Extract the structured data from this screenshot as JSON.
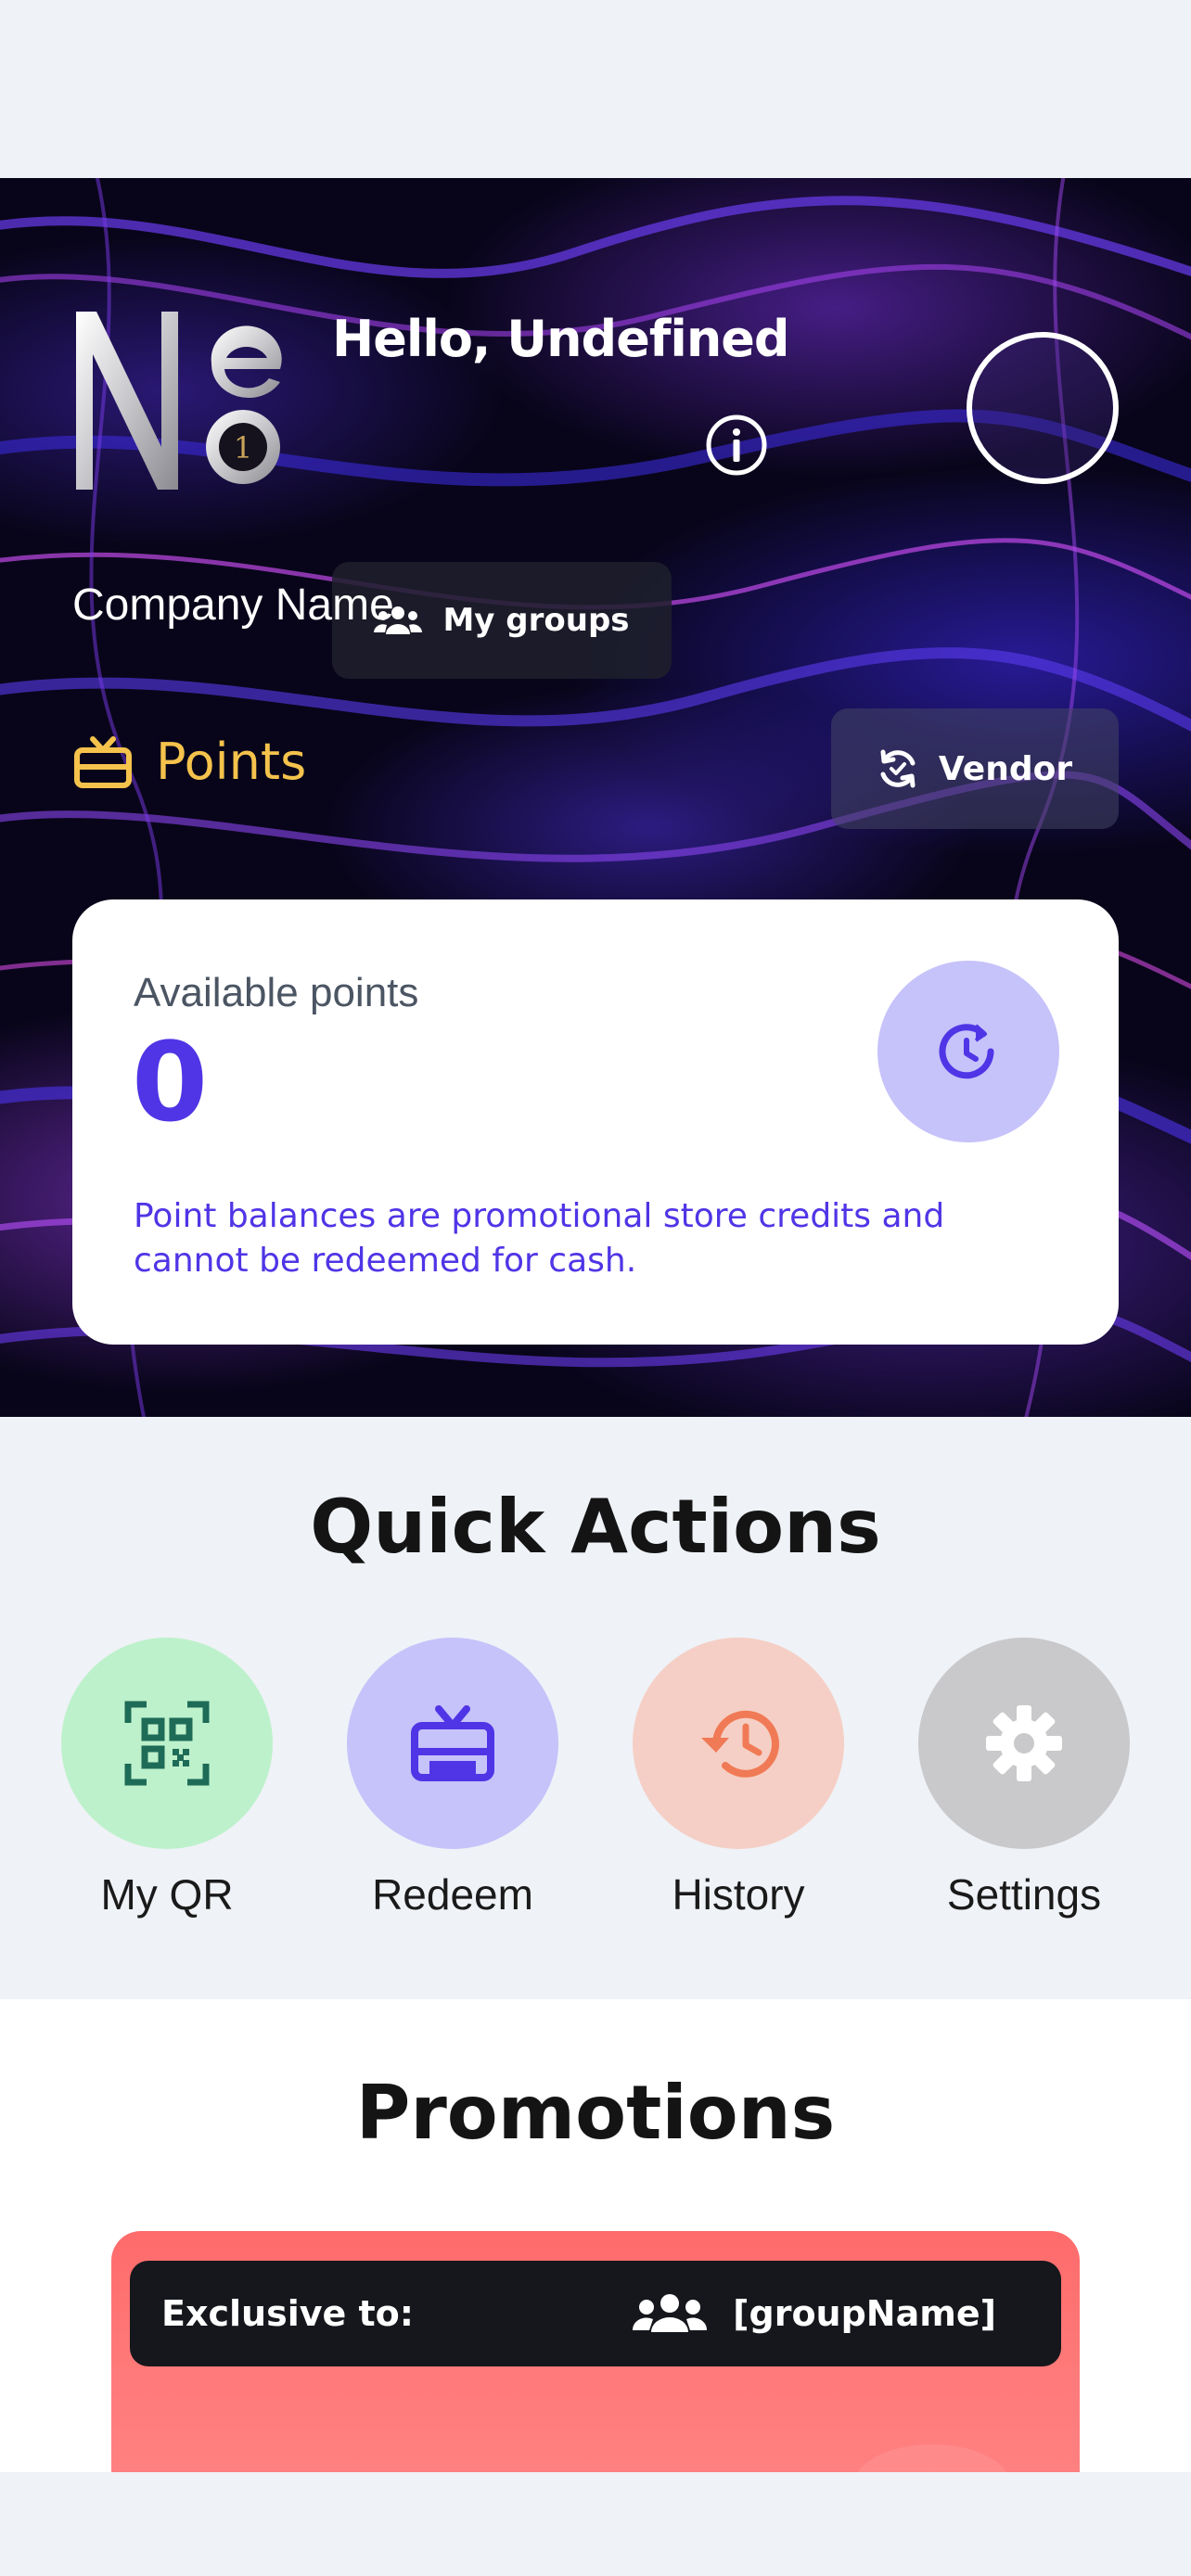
{
  "header": {
    "greeting": "Hello, Undefined",
    "my_groups_label": "My groups",
    "company_name": "Company Name",
    "points_label": "Points",
    "vendor_label": "Vendor"
  },
  "points_card": {
    "available_label": "Available points",
    "available_value": "0",
    "disclaimer": "Point balances are promotional store credits and cannot be redeemed for cash."
  },
  "quick_actions": {
    "title": "Quick Actions",
    "items": [
      {
        "label": "My QR",
        "icon": "qr-code-icon",
        "bg": "#bdf1cb",
        "fg": "#1e6b57"
      },
      {
        "label": "Redeem",
        "icon": "gift-card-icon",
        "bg": "#c6c2fa",
        "fg": "#4f35e6"
      },
      {
        "label": "History",
        "icon": "history-icon",
        "bg": "#f5cfc5",
        "fg": "#f07a55"
      },
      {
        "label": "Settings",
        "icon": "gear-icon",
        "bg": "#c9c9cc",
        "fg": "#ffffff"
      }
    ]
  },
  "promotions": {
    "title": "Promotions",
    "exclusive_label": "Exclusive to:",
    "group_name": "[groupName]"
  },
  "colors": {
    "accent": "#4f35e6",
    "points_gold": "#f5c24c",
    "promo_red": "#ff6b6b"
  }
}
